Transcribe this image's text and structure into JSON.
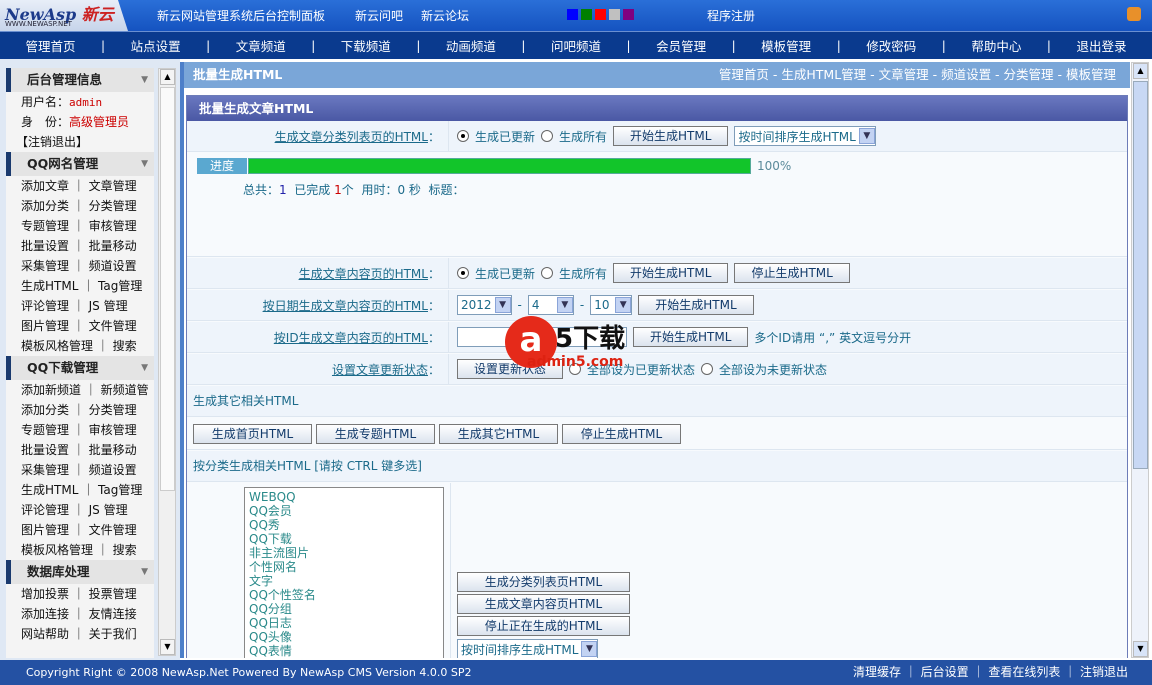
{
  "header": {
    "logo": "NewAsp 新云",
    "logo_sub": "WWW.NEWASP.NET",
    "title": "新云网站管理系统后台控制面板",
    "links": [
      "新云问吧",
      "新云论坛"
    ],
    "register": "程序注册",
    "swatches": [
      "#0000ff",
      "#008000",
      "#ff0000",
      "#c0c0c0",
      "#800080"
    ]
  },
  "nav": [
    "管理首页",
    "站点设置",
    "文章频道",
    "下载频道",
    "动画频道",
    "问吧频道",
    "会员管理",
    "模板管理",
    "修改密码",
    "帮助中心",
    "退出登录"
  ],
  "sidebar": {
    "info": {
      "title": "后台管理信息",
      "user_label": "用户名：",
      "user": "admin",
      "role_label": "身　份：",
      "role": "高级管理员",
      "logout": "【注销退出】"
    },
    "sections": [
      {
        "title": "QQ网名管理",
        "items": [
          "添加文章 ｜ 文章管理",
          "添加分类 ｜ 分类管理",
          "专题管理 ｜ 审核管理",
          "批量设置 ｜ 批量移动",
          "采集管理 ｜ 频道设置",
          "生成HTML ｜ Tag管理",
          "评论管理 ｜ JS 管理",
          "图片管理 ｜ 文件管理",
          "模板风格管理 ｜ 搜索"
        ]
      },
      {
        "title": "QQ下载管理",
        "items": [
          "添加新频道 ｜ 新频道管",
          "添加分类 ｜ 分类管理",
          "专题管理 ｜ 审核管理",
          "批量设置 ｜ 批量移动",
          "采集管理 ｜ 频道设置",
          "生成HTML ｜ Tag管理",
          "评论管理 ｜ JS 管理",
          "图片管理 ｜ 文件管理",
          "模板风格管理 ｜ 搜索"
        ]
      },
      {
        "title": "数据库处理",
        "items": [
          "增加投票 ｜ 投票管理",
          "添加连接 ｜ 友情连接",
          "网站帮助 ｜ 关于我们"
        ]
      }
    ]
  },
  "main": {
    "title": "批量生成HTML",
    "breadcrumb": "管理首页 - 生成HTML管理 - 文章管理 - 频道设置 - 分类管理 - 模板管理",
    "panel_title": "批量生成文章HTML",
    "row1": {
      "label": "生成文章分类列表页的HTML",
      "opt1": "生成已更新",
      "opt2": "生成所有",
      "btn": "开始生成HTML",
      "select": "按时间排序生成HTML"
    },
    "progress": {
      "label": "进度",
      "value": 100,
      "text": "100%",
      "total_label": "总共：",
      "total": "1",
      "done_label": "已完成",
      "done": "1",
      "unit": "个",
      "time_label": "用时：0 秒",
      "title_label": "标题："
    },
    "row2": {
      "label": "生成文章内容页的HTML",
      "opt1": "生成已更新",
      "opt2": "生成所有",
      "btn": "开始生成HTML",
      "stop": "停止生成HTML"
    },
    "row3": {
      "label": "按日期生成文章内容页的HTML",
      "year": "2012",
      "month": "4",
      "day": "10",
      "btn": "开始生成HTML"
    },
    "row4": {
      "label": "按ID生成文章内容页的HTML",
      "btn": "开始生成HTML",
      "hint": "多个ID请用 “,” 英文逗号分开"
    },
    "row5": {
      "label": "设置文章更新状态",
      "btn": "设置更新状态",
      "opt1": "全部设为已更新状态",
      "opt2": "全部设为未更新状态"
    },
    "other_title": "生成其它相关HTML",
    "other_buttons": [
      "生成首页HTML",
      "生成专题HTML",
      "生成其它HTML",
      "停止生成HTML"
    ],
    "cat_title": "按分类生成相关HTML [请按  CTRL 键多选]",
    "categories": [
      "WEBQQ",
      "QQ会员",
      "QQ秀",
      "QQ下载",
      "非主流图片",
      "个性网名",
      "文字",
      "QQ个性签名",
      "QQ分组",
      "QQ日志",
      "QQ头像",
      "QQ表情"
    ],
    "cat_buttons": [
      "生成分类列表页HTML",
      "生成文章内容页HTML",
      "停止正在生成的HTML"
    ],
    "cat_select": "按时间排序生成HTML"
  },
  "footer": {
    "copyright": "Copyright Right © 2008 NewAsp.Net Powered By NewAsp CMS Version 4.0.0 SP2",
    "links": [
      "清理缓存",
      "后台设置",
      "查看在线列表",
      "注销退出"
    ]
  },
  "watermark": "a5下载 admin5.com"
}
